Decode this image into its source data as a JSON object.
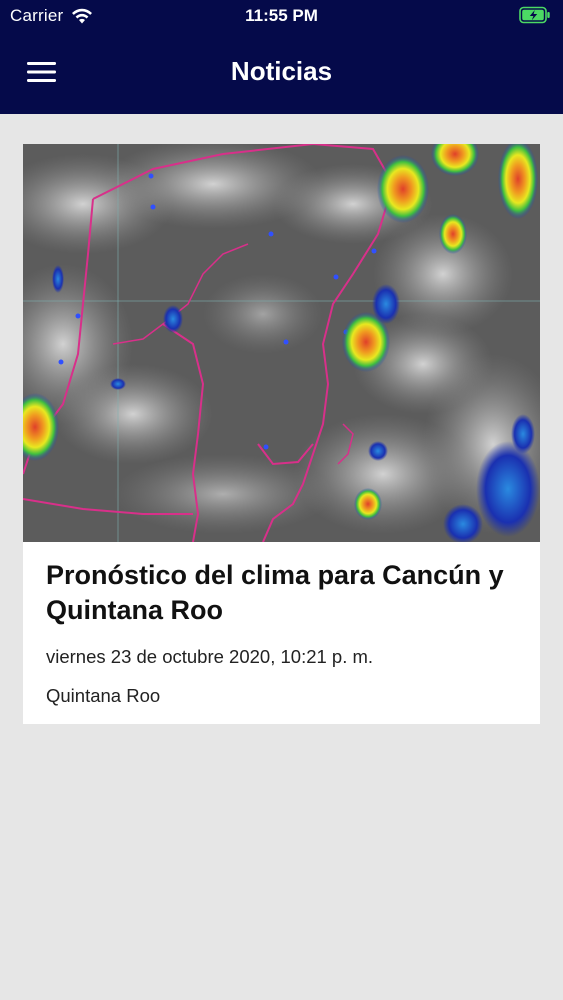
{
  "status_bar": {
    "carrier": "Carrier",
    "time": "11:55 PM",
    "icons": [
      "wifi-icon",
      "battery-charging-icon"
    ],
    "battery_color": "#4cd964"
  },
  "nav_bar": {
    "title": "Noticias",
    "menu_icon": "hamburger-menu-icon",
    "background_color": "#050a4a"
  },
  "news": [
    {
      "title": "Pronóstico del clima para Cancún y Quintana Roo",
      "date": "viernes 23 de octubre 2020, 10:21 p. m.",
      "category": "Quintana Roo",
      "image": "satellite-weather-map-image"
    }
  ]
}
